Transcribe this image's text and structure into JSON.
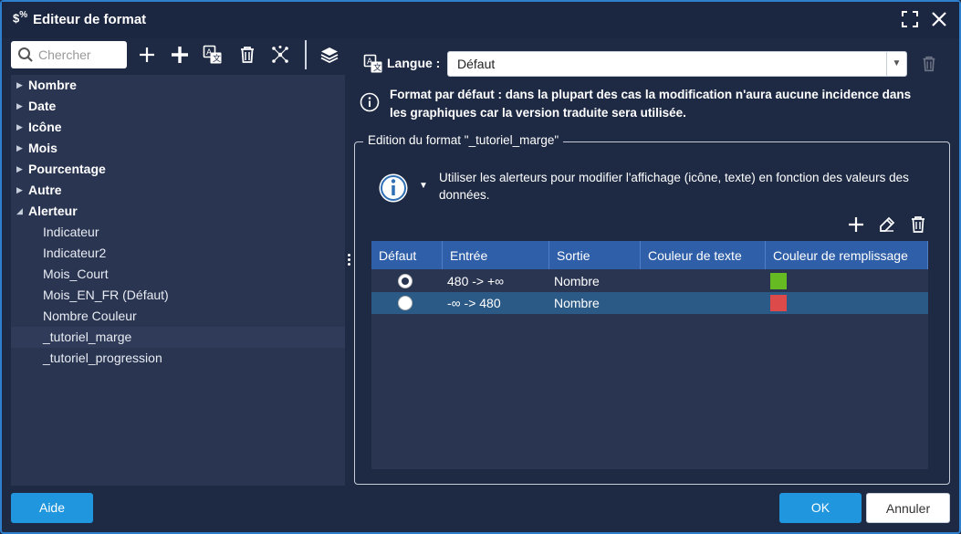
{
  "window": {
    "icon_text": "$",
    "icon_sup": "%",
    "title": "Editeur de format"
  },
  "toolbar": {
    "search_placeholder": "Chercher"
  },
  "tree": {
    "categories": [
      "Nombre",
      "Date",
      "Icône",
      "Mois",
      "Pourcentage",
      "Autre",
      "Alerteur"
    ],
    "alerteur_items": [
      "Indicateur",
      "Indicateur2",
      "Mois_Court",
      "Mois_EN_FR (Défaut)",
      "Nombre Couleur",
      "_tutoriel_marge",
      "_tutoriel_progression"
    ],
    "selected": "_tutoriel_marge"
  },
  "language": {
    "label": "Langue :",
    "value": "Défaut"
  },
  "info": {
    "text": "Format par défaut : dans la plupart des cas la modification n'aura aucune incidence dans les graphiques car la version traduite sera utilisée."
  },
  "edition": {
    "legend": "Edition du format \"_tutoriel_marge\"",
    "alert_text": "Utiliser les alerteurs pour modifier l'affichage (icône, texte) en fonction des valeurs des données."
  },
  "table": {
    "headers": [
      "Défaut",
      "Entrée",
      "Sortie",
      "Couleur de texte",
      "Couleur de remplissage"
    ],
    "rows": [
      {
        "default": true,
        "entree": "480 -> +∞",
        "sortie": "Nombre",
        "text_color": "",
        "fill_color": "#66bb22"
      },
      {
        "default": false,
        "entree": "-∞ -> 480",
        "sortie": "Nombre",
        "text_color": "",
        "fill_color": "#dd4a4a"
      }
    ],
    "selected_row": 1
  },
  "buttons": {
    "help": "Aide",
    "ok": "OK",
    "cancel": "Annuler"
  },
  "colors": {
    "background": "#1e2a44",
    "panel": "#2a3552",
    "accent": "#1f96dd",
    "table_header": "#2f5fa8",
    "selected_row": "#2c5a86"
  }
}
